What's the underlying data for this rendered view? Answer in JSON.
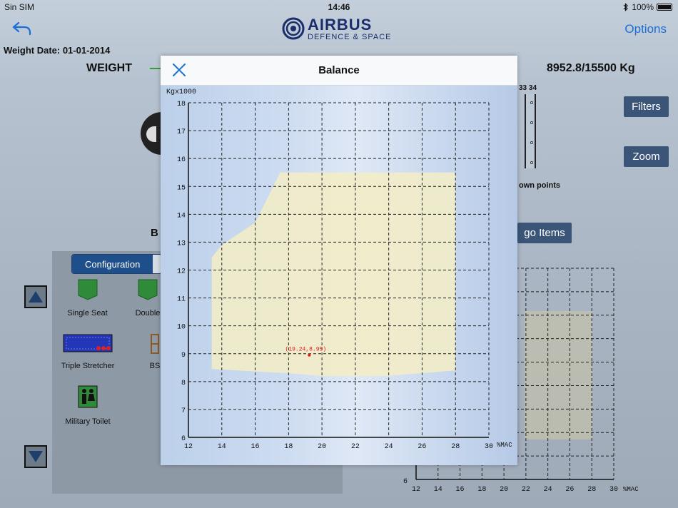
{
  "status_bar": {
    "carrier": "Sin SIM",
    "time": "14:46",
    "battery": "100%"
  },
  "nav": {
    "logo_brand": "AIRBUS",
    "logo_sub": "DEFENCE & SPACE",
    "options_label": "Options",
    "back_icon": "back-arrow-icon"
  },
  "weight_date": "Weight Date: 01-01-2014",
  "weight": {
    "label": "WEIGHT",
    "value": "8952.8/15500 Kg"
  },
  "seat_numbers": "33 34",
  "down_points_label": "own points",
  "buttons": {
    "filters": "Filters",
    "zoom": "Zoom",
    "cargo_items": "go Items"
  },
  "bi_label": "B",
  "config": {
    "tab_active": "Configuration",
    "items": [
      {
        "label": "Single Seat",
        "icon": "single-seat-icon"
      },
      {
        "label": "Double",
        "icon": "double-seat-icon"
      },
      {
        "label": "Triple Stretcher",
        "icon": "triple-stretcher-icon"
      },
      {
        "label": "BS",
        "icon": "bs-icon"
      },
      {
        "label": "Military Toilet",
        "icon": "military-toilet-icon"
      }
    ]
  },
  "modal": {
    "title": "Balance",
    "close_icon": "close-icon"
  },
  "chart_data": {
    "type": "scatter",
    "ylabel": "Kgx1000",
    "xlabel": "%MAC",
    "xlim": [
      12,
      30
    ],
    "ylim": [
      6,
      18
    ],
    "x_ticks": [
      12,
      14,
      16,
      18,
      20,
      22,
      24,
      26,
      28,
      30
    ],
    "y_ticks": [
      6,
      7,
      8,
      9,
      10,
      11,
      12,
      13,
      14,
      15,
      16,
      17,
      18
    ],
    "grid": true,
    "envelope": [
      [
        13.4,
        8.45
      ],
      [
        13.4,
        12.45
      ],
      [
        14.0,
        12.9
      ],
      [
        16.0,
        13.7
      ],
      [
        17.5,
        15.5
      ],
      [
        28.0,
        15.5
      ],
      [
        28.0,
        8.4
      ],
      [
        23.8,
        8.2
      ],
      [
        20.0,
        8.2
      ],
      [
        18.0,
        8.3
      ],
      [
        13.4,
        8.45
      ]
    ],
    "point": {
      "x": 19.24,
      "y": 8.95,
      "label": "(19.24,8.95)"
    },
    "colors": {
      "envelope": "#f2ecc8",
      "point": "#e01b1b",
      "grid": "#222222"
    }
  },
  "bg_chart": {
    "x_ticks": [
      12,
      14,
      16,
      18,
      20,
      22,
      24,
      26,
      28,
      30
    ],
    "xlabel": "%MAC",
    "y_tick_bottom": "6"
  }
}
